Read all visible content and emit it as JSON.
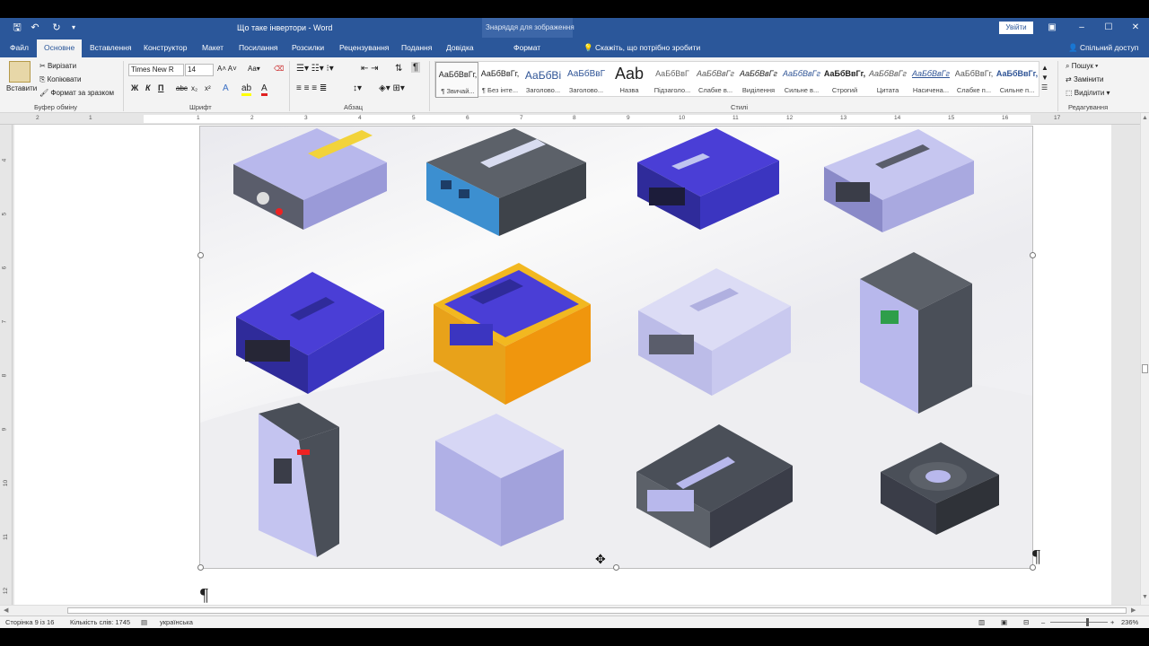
{
  "title_bar": {
    "document_title": "Що таке інвертори  -  Word",
    "context_group": "Знаряддя для зображення",
    "sign_in": "Увійти",
    "quick_access": [
      "save-icon",
      "undo-icon",
      "redo-icon",
      "customize-icon"
    ],
    "window_controls": [
      "ribbon-display-icon",
      "minimize-icon",
      "maximize-icon",
      "close-icon"
    ]
  },
  "tabs": {
    "items": [
      "Файл",
      "Основне",
      "Вставлення",
      "Конструктор",
      "Макет",
      "Посилання",
      "Розсилки",
      "Рецензування",
      "Подання",
      "Довідка",
      "Формат"
    ],
    "active": "Основне",
    "tell_me": "Скажіть, що потрібно зробити",
    "share": "Спільний доступ"
  },
  "ribbon": {
    "clipboard": {
      "paste": "Вставити",
      "cut": "Вирізати",
      "copy": "Копіювати",
      "format_painter": "Формат за зразком",
      "group": "Буфер обміну"
    },
    "font": {
      "name": "Times New R",
      "size": "14",
      "bold": "Ж",
      "italic": "К",
      "underline": "П",
      "strike": "abc",
      "sub": "x₂",
      "sup": "x²",
      "group": "Шрифт"
    },
    "paragraph": {
      "group": "Абзац"
    },
    "styles": {
      "items": [
        {
          "preview": "АаБбВвГг,",
          "name": "¶ Звичай..."
        },
        {
          "preview": "АаБбВвГг,",
          "name": "¶ Без інте..."
        },
        {
          "preview": "АаБбВі",
          "name": "Заголово..."
        },
        {
          "preview": "АаБбВвГ",
          "name": "Заголово..."
        },
        {
          "preview": "Aab",
          "name": "Назва"
        },
        {
          "preview": "АаБбВвГ",
          "name": "Підзаголо..."
        },
        {
          "preview": "АаБбВвГг",
          "name": "Слабке в..."
        },
        {
          "preview": "АаБбВвГг",
          "name": "Виділення"
        },
        {
          "preview": "АаБбВвГг",
          "name": "Сильне в..."
        },
        {
          "preview": "АаБбВвГг,",
          "name": "Строгий"
        },
        {
          "preview": "АаБбВвГг",
          "name": "Цитата"
        },
        {
          "preview": "АаБбВвГг",
          "name": "Насичена..."
        },
        {
          "preview": "АаБбВвГг,",
          "name": "Слабке п..."
        },
        {
          "preview": "АаБбВвГг,",
          "name": "Сильне п..."
        }
      ],
      "group": "Стилі"
    },
    "editing": {
      "find": "Пошук",
      "replace": "Замінити",
      "select": "Виділити",
      "group": "Редагування"
    }
  },
  "ruler": {
    "marks": [
      "1",
      "2",
      "1",
      "2",
      "3",
      "4",
      "5",
      "6",
      "7",
      "8",
      "9",
      "10",
      "11",
      "12",
      "13",
      "14",
      "15",
      "16",
      "17"
    ],
    "vmarks": [
      "4",
      "5",
      "6",
      "7",
      "8",
      "9",
      "10",
      "11",
      "12"
    ]
  },
  "document": {
    "image_alt": "Набір ізометричних іконок інверторів",
    "pilcrow": "¶"
  },
  "status_bar": {
    "page": "Сторінка 9 із 16",
    "words": "Кількість слів: 1745",
    "language": "українська",
    "zoom": "236%"
  }
}
